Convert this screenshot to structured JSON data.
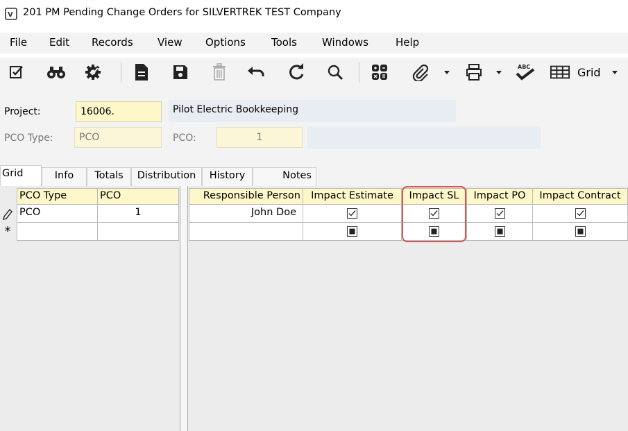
{
  "window": {
    "title": "201 PM Pending Change Orders for SILVERTREK TEST Company"
  },
  "menu": [
    "File",
    "Edit",
    "Records",
    "View",
    "Options",
    "Tools",
    "Windows",
    "Help"
  ],
  "toolbar": {
    "icons": [
      "check-list-icon",
      "binoculars-icon",
      "settings-gear-icon",
      "new-document-icon",
      "save-icon",
      "delete-icon",
      "undo-icon",
      "refresh-icon",
      "search-icon",
      "calculator-icon",
      "attachment-icon",
      "print-icon",
      "spellcheck-icon",
      "grid-view-icon"
    ],
    "grid_label": "Grid",
    "spellcheck_badge": "ABC"
  },
  "form": {
    "project_label": "Project:",
    "project_value": "16006.",
    "project_desc": "Pilot Electric Bookkeeping",
    "pco_type_label": "PCO Type:",
    "pco_type_value": "PCO",
    "pco_label": "PCO:",
    "pco_value": "1",
    "pco_desc": ""
  },
  "tabs": [
    "Grid",
    "Info",
    "Totals",
    "Distribution",
    "History",
    "Notes"
  ],
  "grid": {
    "left_columns": [
      "PCO Type",
      "PCO"
    ],
    "right_columns": [
      "Responsible Person",
      "Impact Estimate",
      "Impact SL",
      "Impact PO",
      "Impact Contract"
    ],
    "rows": [
      {
        "indicator": "pencil-icon",
        "pco_type": "PCO",
        "pco": "1",
        "responsible_person": "John Doe",
        "impact_estimate": true,
        "impact_sl": true,
        "impact_po": true,
        "impact_contract": true
      },
      {
        "indicator": "asterisk-icon",
        "pco_type": "",
        "pco": "",
        "responsible_person": "",
        "impact_estimate": null,
        "impact_sl": null,
        "impact_po": null,
        "impact_contract": null
      }
    ],
    "new_row_marker": "*"
  },
  "colors": {
    "highlight": "#d9534f",
    "field_yellow": "#fdf7c9",
    "field_blue": "#e8edf3"
  }
}
